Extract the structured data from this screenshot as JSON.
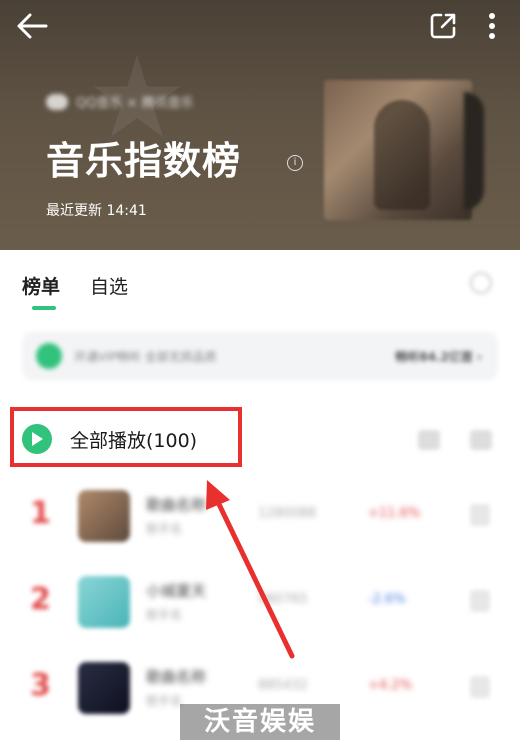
{
  "header": {
    "brand_text": "QQ音乐 × 腾讯音乐",
    "title": "音乐指数榜",
    "info_symbol": "i",
    "updated_label": "最近更新 14:41",
    "background_color": "#5c5041"
  },
  "tabs": [
    {
      "label": "榜单",
      "active": true
    },
    {
      "label": "自选",
      "active": false
    }
  ],
  "vip_banner": {
    "text": "开通VIP畅听 全部无损品质",
    "action": "畅听84.2亿首 ›"
  },
  "play_all": {
    "label": "全部播放(100)",
    "accent_color": "#31c27c"
  },
  "highlight_color": "#e8302e",
  "songs": [
    {
      "rank": "1",
      "name": "歌曲名称",
      "artist": "歌手名",
      "index": "1280088",
      "change": "+11.6%",
      "change_color": "#e24a4a"
    },
    {
      "rank": "2",
      "name": "小城夏天",
      "artist": "歌手名",
      "index": "980765",
      "change": "-2.6%",
      "change_color": "#4a7be2"
    },
    {
      "rank": "3",
      "name": "歌曲名称",
      "artist": "歌手名",
      "index": "885432",
      "change": "+4.2%",
      "change_color": "#e24a4a"
    }
  ],
  "watermark": "沃音娱娱"
}
